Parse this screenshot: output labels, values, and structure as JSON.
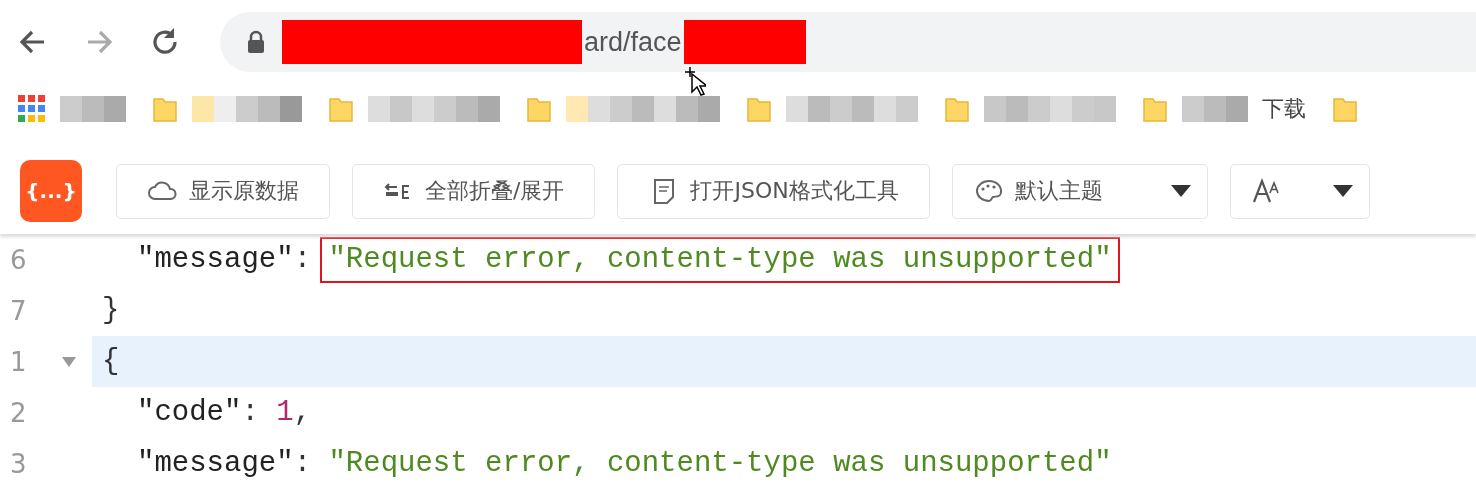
{
  "address_bar": {
    "segments": [
      {
        "kind": "redacted"
      },
      {
        "kind": "text",
        "text": "ard/face"
      },
      {
        "kind": "redacted"
      }
    ]
  },
  "bookmarks": [
    {
      "kind": "apps"
    },
    {
      "kind": "blurred"
    },
    {
      "kind": "blurred"
    },
    {
      "kind": "blurred"
    },
    {
      "kind": "blurred"
    },
    {
      "kind": "blurred"
    },
    {
      "kind": "blurred",
      "label": "下载"
    },
    {
      "kind": "folder"
    }
  ],
  "toolbar": {
    "logo": "{...}",
    "buttons": [
      {
        "kind": "button",
        "label": "显示原数据"
      },
      {
        "kind": "button",
        "label": "全部折叠/展开"
      },
      {
        "kind": "button",
        "label": "打开JSON格式化工具"
      },
      {
        "kind": "dropdown",
        "label": "默认主题"
      },
      {
        "kind": "dropdown"
      }
    ]
  },
  "code": [
    {
      "children": [
        {
          "number": "6",
          "highlighted": false,
          "foldable": false,
          "tokens": [
            {
              "kind": "key",
              "text": "\"message\""
            },
            {
              "kind": "punct",
              "text": ": "
            },
            {
              "kind": "string",
              "text": "\"Request error, content-type was unsupported\"",
              "boxed": true
            }
          ]
        }
      ]
    },
    {
      "number": "7",
      "highlighted": false,
      "foldable": false,
      "tokens": [
        {
          "kind": "punct",
          "text": "}"
        }
      ]
    },
    {
      "number": "1",
      "highlighted": true,
      "foldable": true,
      "tokens": [
        {
          "kind": "punct",
          "text": "{"
        }
      ],
      "children": [
        {
          "number": "2",
          "highlighted": false,
          "foldable": false,
          "tokens": [
            {
              "kind": "key",
              "text": "\"code\""
            },
            {
              "kind": "punct",
              "text": ": "
            },
            {
              "kind": "number",
              "text": "1"
            },
            {
              "kind": "punct",
              "text": ","
            }
          ]
        },
        {
          "number": "3",
          "highlighted": false,
          "foldable": false,
          "tokens": [
            {
              "kind": "key",
              "text": "\"message\""
            },
            {
              "kind": "punct",
              "text": ": "
            },
            {
              "kind": "string",
              "text": "\"Request error, content-type was unsupported\"",
              "boxed": false
            }
          ]
        }
      ]
    }
  ]
}
